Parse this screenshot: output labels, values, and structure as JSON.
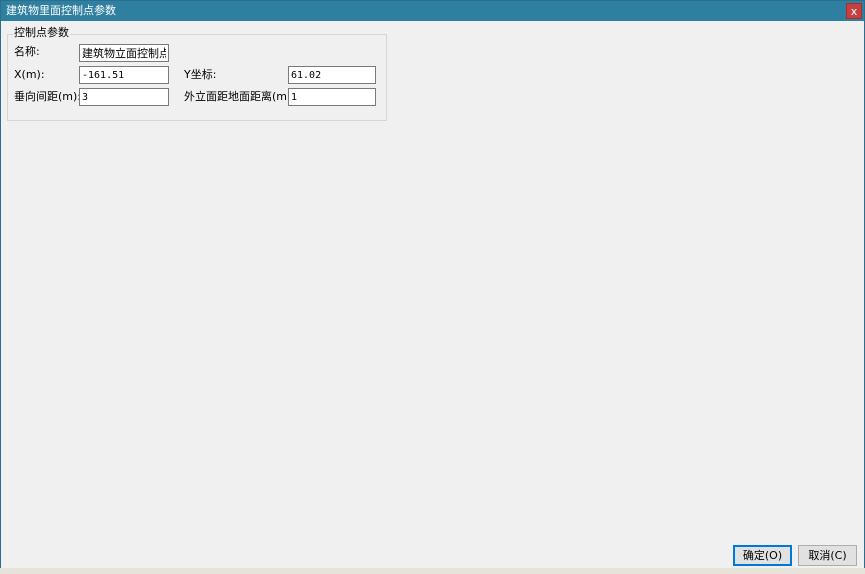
{
  "window": {
    "title": "建筑物里面控制点参数",
    "close_label": "x"
  },
  "group": {
    "legend": "控制点参数"
  },
  "fields": {
    "name_label": "名称:",
    "name_value": "建筑物立面控制点",
    "x_label": "X(m):",
    "x_value": "-161.51",
    "y_label": "Y坐标:",
    "y_value": "61.02",
    "vspacing_label": "垂向间距(m):",
    "vspacing_value": "3",
    "facade_label": "外立面距地面距离(m):",
    "facade_value": "1"
  },
  "buttons": {
    "ok_label": "确定(O)",
    "cancel_label": "取消(C)"
  },
  "colors": {
    "titlebar": "#2e7fa0",
    "close_button": "#c44141",
    "dialog_bg": "#f0f0f0",
    "default_button_border": "#0078d7"
  }
}
